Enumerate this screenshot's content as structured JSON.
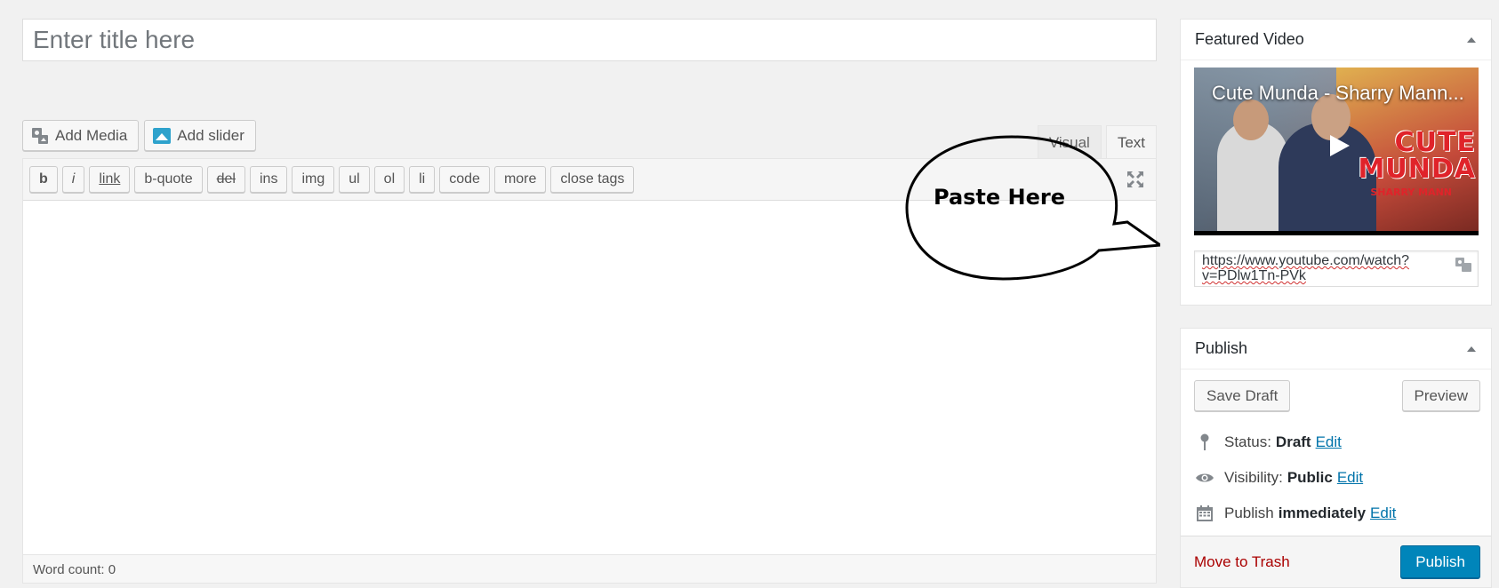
{
  "title_field": {
    "placeholder": "Enter title here",
    "value": ""
  },
  "media_buttons": {
    "add_media": "Add Media",
    "add_slider": "Add slider"
  },
  "editor_tabs": {
    "visual": "Visual",
    "text": "Text",
    "active": "Text"
  },
  "quicktags": {
    "b": "b",
    "i": "i",
    "link": "link",
    "b_quote": "b-quote",
    "del": "del",
    "ins": "ins",
    "img": "img",
    "ul": "ul",
    "ol": "ol",
    "li": "li",
    "code": "code",
    "more": "more",
    "close_tags": "close tags"
  },
  "word_count": "Word count: 0",
  "callout": {
    "text": "Paste Here"
  },
  "featured_video": {
    "title": "Featured Video",
    "video_title": "Cute Munda - Sharry Mann...",
    "thumb_brand_line1": "CUTE",
    "thumb_brand_line2": "MUNDA",
    "thumb_brand_sub": "SHARRY MANN",
    "url": "https://www.youtube.com/watch?v=PDlw1Tn-PVk"
  },
  "publish": {
    "title": "Publish",
    "save_draft": "Save Draft",
    "preview": "Preview",
    "status_label": "Status:",
    "status_value": "Draft",
    "visibility_label": "Visibility:",
    "visibility_value": "Public",
    "schedule_label": "Publish",
    "schedule_value": "immediately",
    "edit": "Edit",
    "move_to_trash": "Move to Trash",
    "publish_button": "Publish"
  },
  "colors": {
    "background": "#f1f1f1",
    "primary_button": "#0085ba",
    "link": "#0073aa",
    "trash": "#a00"
  },
  "icons": {
    "add_media": "media-camera-icon",
    "add_slider": "slider-image-icon",
    "fullscreen": "fullscreen-icon",
    "toggle": "caret-up-icon",
    "status": "pin-icon",
    "visibility": "eye-icon",
    "schedule": "calendar-icon",
    "play": "play-icon"
  }
}
